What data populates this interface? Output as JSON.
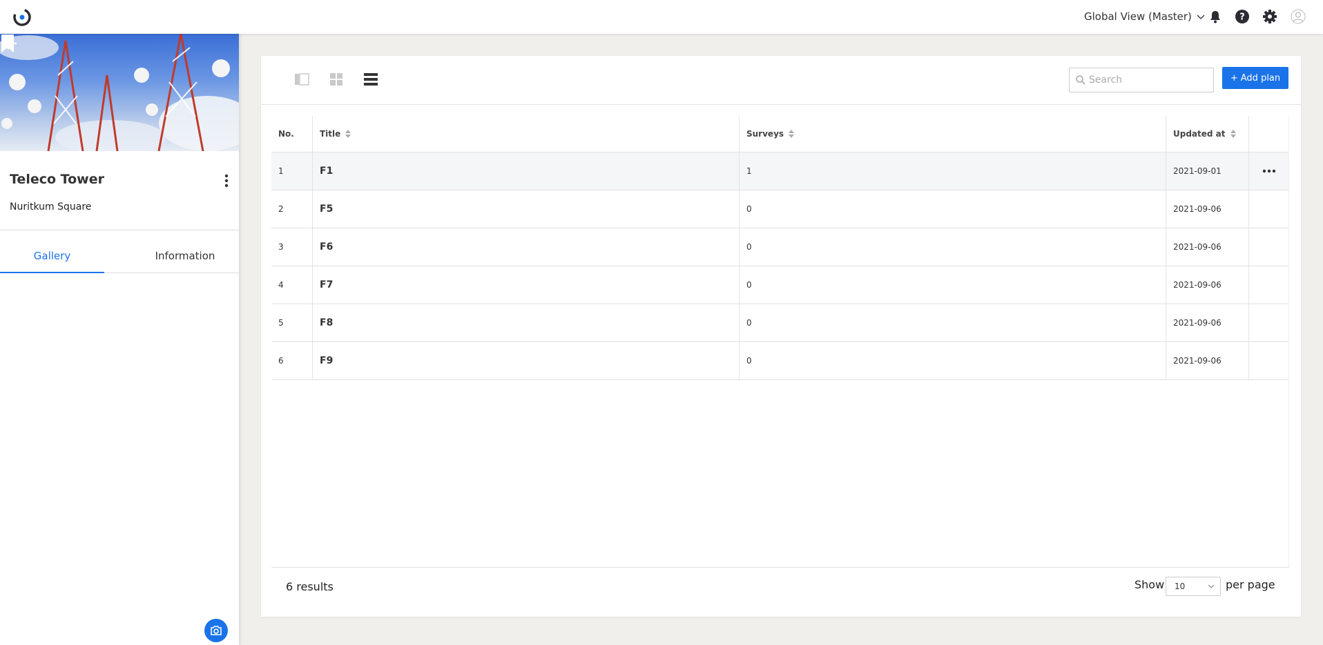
{
  "header": {
    "account_label": "Global View (Master)"
  },
  "sidebar": {
    "site_title": "Teleco Tower",
    "site_subtitle": "Nuritkum Square",
    "tabs": [
      {
        "label": "Gallery",
        "active": true
      },
      {
        "label": "Information",
        "active": false
      }
    ]
  },
  "toolbar": {
    "search_placeholder": "Search",
    "add_label": "Add plan"
  },
  "table": {
    "columns": [
      "No.",
      "Title",
      "Surveys",
      "Updated at"
    ],
    "rows": [
      {
        "no": "1",
        "title": "F1",
        "surveys": "1",
        "updated": "2021-09-01"
      },
      {
        "no": "2",
        "title": "F5",
        "surveys": "0",
        "updated": "2021-09-06"
      },
      {
        "no": "3",
        "title": "F6",
        "surveys": "0",
        "updated": "2021-09-06"
      },
      {
        "no": "4",
        "title": "F7",
        "surveys": "0",
        "updated": "2021-09-06"
      },
      {
        "no": "5",
        "title": "F8",
        "surveys": "0",
        "updated": "2021-09-06"
      },
      {
        "no": "6",
        "title": "F9",
        "surveys": "0",
        "updated": "2021-09-06"
      }
    ]
  },
  "footer": {
    "results_label": "6 results",
    "show_label": "Show",
    "per_page_value": "10",
    "per_page_label": "per page"
  },
  "colors": {
    "accent": "#1a73e8",
    "background": "#f1efeb"
  }
}
